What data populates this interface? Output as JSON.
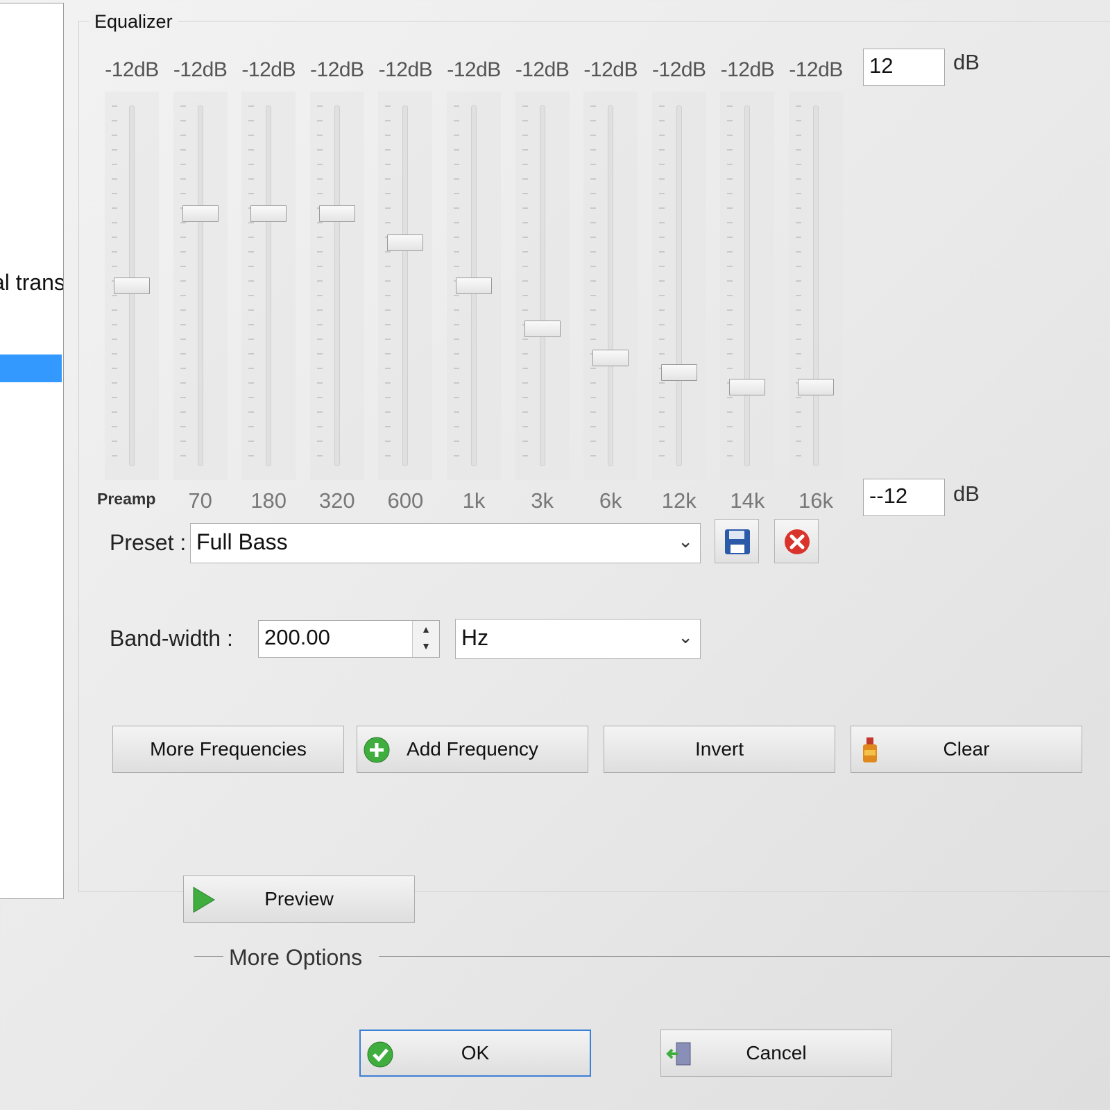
{
  "left_panel": {
    "item_text": "al trans"
  },
  "equalizer": {
    "title": "Equalizer",
    "bands": [
      {
        "db_label": "-12dB",
        "freq": "Preamp",
        "level": 0.5
      },
      {
        "db_label": "-12dB",
        "freq": "70",
        "level": 0.7
      },
      {
        "db_label": "-12dB",
        "freq": "180",
        "level": 0.7
      },
      {
        "db_label": "-12dB",
        "freq": "320",
        "level": 0.7
      },
      {
        "db_label": "-12dB",
        "freq": "600",
        "level": 0.62
      },
      {
        "db_label": "-12dB",
        "freq": "1k",
        "level": 0.5
      },
      {
        "db_label": "-12dB",
        "freq": "3k",
        "level": 0.38
      },
      {
        "db_label": "-12dB",
        "freq": "6k",
        "level": 0.3
      },
      {
        "db_label": "-12dB",
        "freq": "12k",
        "level": 0.26
      },
      {
        "db_label": "-12dB",
        "freq": "14k",
        "level": 0.22
      },
      {
        "db_label": "-12dB",
        "freq": "16k",
        "level": 0.22
      }
    ],
    "max_value": "12",
    "min_value": "--12",
    "unit": "dB"
  },
  "preset": {
    "label": "Preset :",
    "value": "Full Bass"
  },
  "bandwidth": {
    "label": "Band-width :",
    "value": "200.00",
    "unit": "Hz"
  },
  "buttons": {
    "more_frequencies": "More Frequencies",
    "add_frequency": "Add Frequency",
    "invert": "Invert",
    "clear": "Clear",
    "preview": "Preview",
    "ok": "OK",
    "cancel": "Cancel"
  },
  "more_options": "More Options",
  "colors": {
    "selection": "#3399ff",
    "green": "#3fae3f",
    "red": "#d9342b",
    "save_blue": "#2b5aa8"
  }
}
